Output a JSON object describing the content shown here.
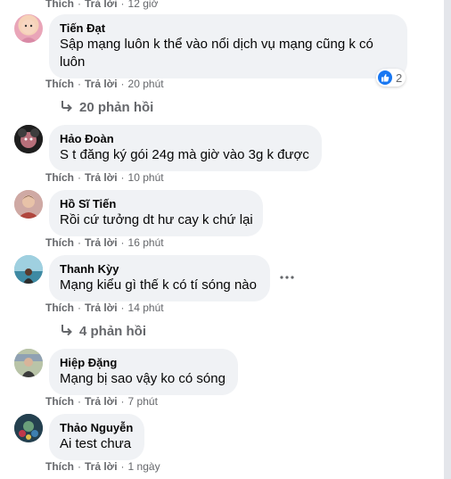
{
  "comments": [
    {
      "author": "",
      "text": "",
      "actions": {
        "like": "Thích",
        "reply": "Trả lời",
        "time": "12 giờ"
      }
    },
    {
      "author": "Tiến Đạt",
      "text_lines": [
        "Sập mạng luôn k thể vào nổi dịch vụ mạng cũng k có",
        "luôn"
      ],
      "actions": {
        "like": "Thích",
        "reply": "Trả lời",
        "time": "20 phút"
      },
      "reaction_count": "2",
      "replies": "20 phản hồi"
    },
    {
      "author": "Hảo Đoàn",
      "text": "S t đăng ký gói 24g mà giờ vào 3g k được",
      "actions": {
        "like": "Thích",
        "reply": "Trả lời",
        "time": "10 phút"
      }
    },
    {
      "author": "Hồ Sĩ Tiến",
      "text": "Rồi cứ tưởng dt hư cay k chứ lại",
      "actions": {
        "like": "Thích",
        "reply": "Trả lời",
        "time": "16 phút"
      }
    },
    {
      "author": "Thanh Kỳy",
      "text": "Mạng kiểu gì thế k có tí sóng nào",
      "actions": {
        "like": "Thích",
        "reply": "Trả lời",
        "time": "14 phút"
      },
      "replies": "4 phản hồi"
    },
    {
      "author": "Hiệp Đặng",
      "text": "Mạng bị sao vậy ko có sóng",
      "actions": {
        "like": "Thích",
        "reply": "Trả lời",
        "time": "7 phút"
      }
    },
    {
      "author": "Thảo Nguyễn",
      "text": "Ai test chưa",
      "actions": {
        "like": "Thích",
        "reply": "Trả lời",
        "time": "1 ngày"
      }
    }
  ],
  "separator": "·",
  "colors": {
    "bubble": "#f0f2f5",
    "meta": "#65676b",
    "like_blue": "#1877f2"
  },
  "icons": [
    "reply-arrow-icon",
    "like-icon",
    "more-options-icon"
  ]
}
